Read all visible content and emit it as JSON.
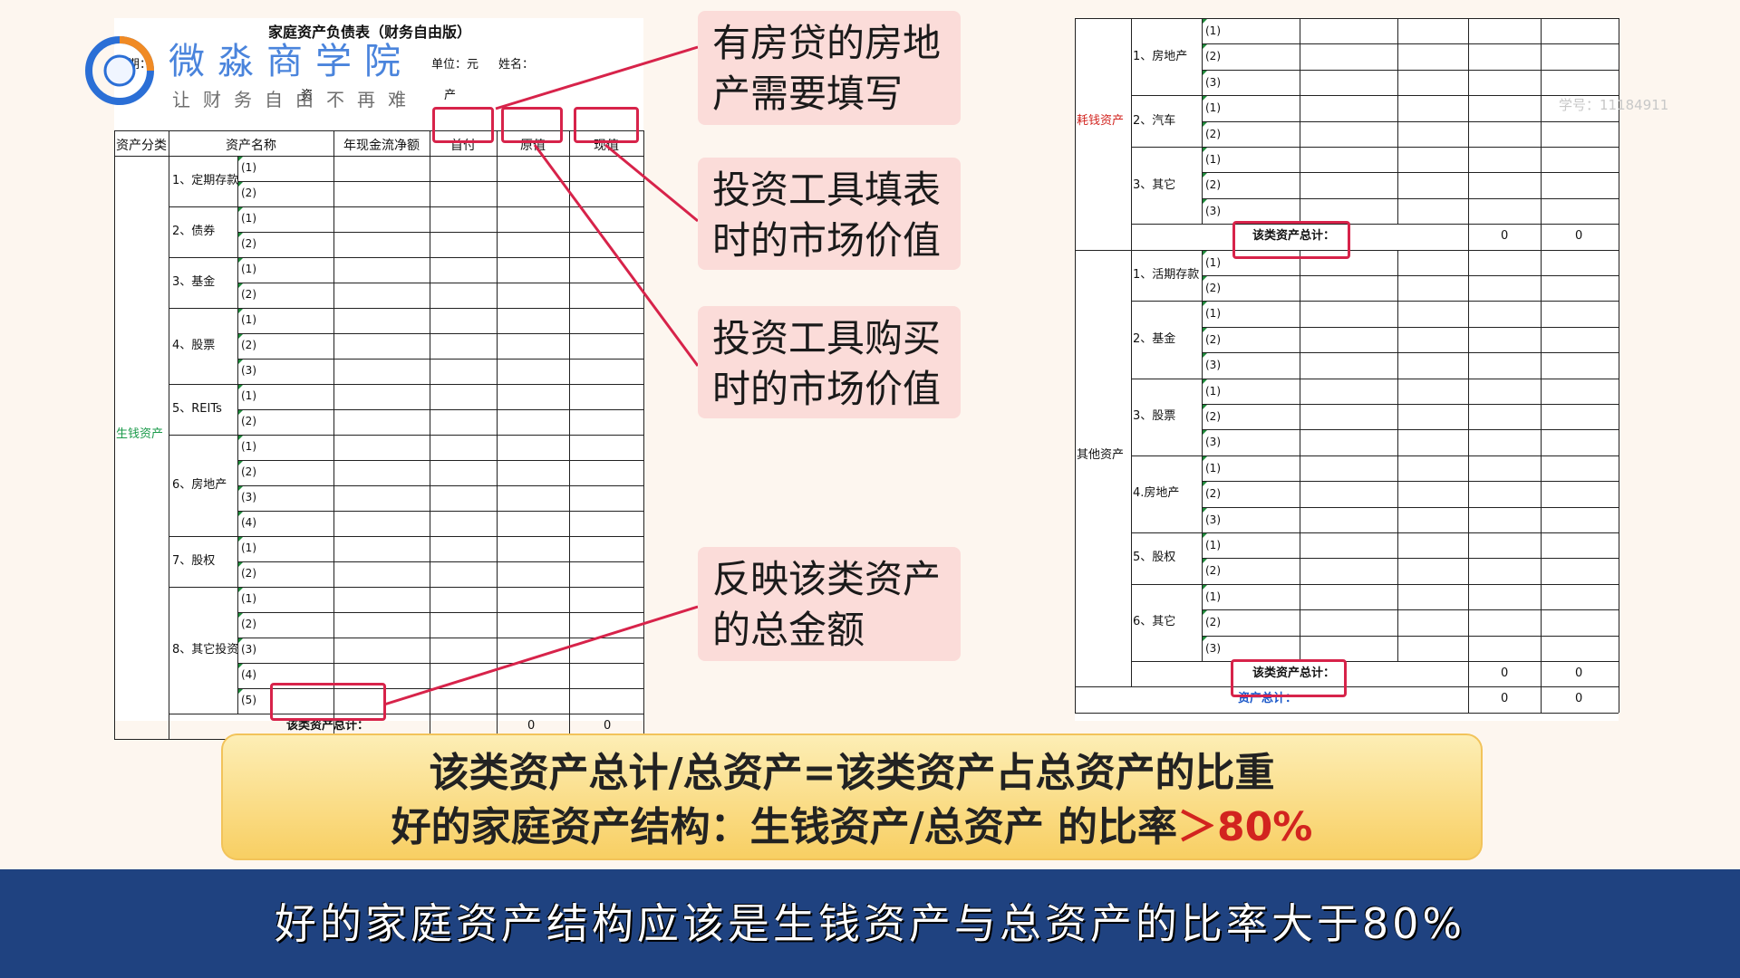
{
  "left_sheet": {
    "title": "家庭资产负债表（财务自由版）",
    "date_label": "日期：",
    "unit_label": "单位：元",
    "name_label": "姓名：",
    "section_label": "资",
    "section_label2": "产",
    "headers": [
      "资产分类",
      "资产名称",
      "年现金流净额",
      "首付",
      "原值",
      "现值"
    ],
    "category": "生钱资产",
    "groups": [
      {
        "name": "1、定期存款",
        "subs": [
          "(1)",
          "(2)"
        ]
      },
      {
        "name": "2、债券",
        "subs": [
          "(1)",
          "(2)"
        ]
      },
      {
        "name": "3、基金",
        "subs": [
          "(1)",
          "(2)"
        ]
      },
      {
        "name": "4、股票",
        "subs": [
          "(1)",
          "(2)",
          "(3)"
        ]
      },
      {
        "name": "5、REITs",
        "subs": [
          "(1)",
          "(2)"
        ]
      },
      {
        "name": "6、房地产",
        "subs": [
          "(1)",
          "(2)",
          "(3)",
          "(4)"
        ]
      },
      {
        "name": "7、股权",
        "subs": [
          "(1)",
          "(2)"
        ]
      },
      {
        "name": "8、其它投资",
        "subs": [
          "(1)",
          "(2)",
          "(3)",
          "(4)",
          "(5)"
        ]
      }
    ],
    "total_label": "该类资产总计：",
    "total_values": [
      "0",
      "0"
    ]
  },
  "right_sheet": {
    "category1": "耗钱资产",
    "groups1": [
      {
        "name": "1、房地产",
        "subs": [
          "(1)",
          "(2)",
          "(3)"
        ]
      },
      {
        "name": "2、汽车",
        "subs": [
          "(1)",
          "(2)"
        ]
      },
      {
        "name": "3、其它",
        "subs": [
          "(1)",
          "(2)",
          "(3)"
        ]
      }
    ],
    "total1_label": "该类资产总计：",
    "total1_values": [
      "0",
      "0"
    ],
    "category2": "其他资产",
    "groups2": [
      {
        "name": "1、活期存款",
        "subs": [
          "(1)",
          "(2)"
        ]
      },
      {
        "name": "2、基金",
        "subs": [
          "(1)",
          "(2)",
          "(3)"
        ]
      },
      {
        "name": "3、股票",
        "subs": [
          "(1)",
          "(2)",
          "(3)"
        ]
      },
      {
        "name": "4.房地产",
        "subs": [
          "(1)",
          "(2)",
          "(3)"
        ]
      },
      {
        "name": "5、股权",
        "subs": [
          "(1)",
          "(2)"
        ]
      },
      {
        "name": "6、其它",
        "subs": [
          "(1)",
          "(2)",
          "(3)"
        ]
      }
    ],
    "total2_label": "该类资产总计：",
    "total2_values": [
      "0",
      "0"
    ],
    "grand_total_label": "资产总计：",
    "grand_total_values": [
      "0",
      "0"
    ]
  },
  "logo": {
    "name": "微淼商学院",
    "slogan": "让财务自由不再难"
  },
  "watermark": "学号：11184911",
  "callouts": [
    "有房贷的房地产需要填写",
    "投资工具填表时的市场价值",
    "投资工具购买时的市场价值",
    "反映该类资产的总金额"
  ],
  "banner": {
    "line1": "该类资产总计/总资产=该类资产占总资产的比重",
    "line2_prefix": "好的家庭资产结构：生钱资产/总资产 的比率",
    "line2_accent": "＞80%"
  },
  "subtitle": "好的家庭资产结构应该是生钱资产与总资产的比率大于80%",
  "colors": {
    "highlight": "#d7234a",
    "subtitle_bg": "#1f4280",
    "banner_accent": "#d2241f",
    "category_green": "#1a9a4a",
    "category_red": "#d2241f",
    "total_blue": "#1b58c9"
  }
}
